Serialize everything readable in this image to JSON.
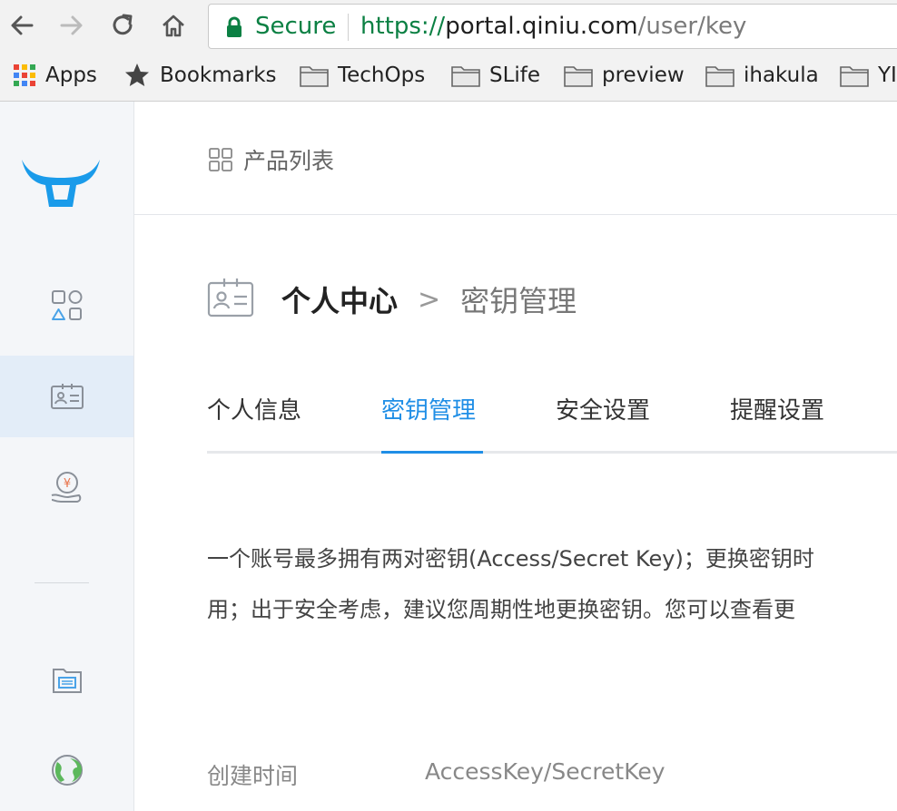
{
  "browser": {
    "security_label": "Secure",
    "url_scheme": "https://",
    "url_host": "portal.qiniu.com",
    "url_path": "/user/key",
    "nav": [
      "back-icon",
      "forward-icon",
      "reload-icon",
      "home-icon"
    ],
    "bookmarks": [
      {
        "label": "Apps",
        "icon": "apps-grid-icon"
      },
      {
        "label": "Bookmarks",
        "icon": "star-icon"
      },
      {
        "label": "TechOps",
        "icon": "folder-icon"
      },
      {
        "label": "SLife",
        "icon": "folder-icon"
      },
      {
        "label": "preview",
        "icon": "folder-icon"
      },
      {
        "label": "ihakula",
        "icon": "folder-icon"
      },
      {
        "label": "YI",
        "icon": "folder-icon"
      }
    ]
  },
  "sidebar": {
    "logo": "qiniu-logo",
    "items": [
      {
        "icon": "products-icon",
        "active": false
      },
      {
        "icon": "id-card-icon",
        "active": true
      },
      {
        "icon": "finance-icon",
        "active": false
      },
      {
        "icon": "ticket-icon",
        "active": false
      },
      {
        "icon": "globe-icon",
        "active": false
      }
    ]
  },
  "topbar": {
    "product_list_label": "产品列表"
  },
  "breadcrumb": {
    "root": "个人中心",
    "separator": ">",
    "current": "密钥管理"
  },
  "tabs": [
    {
      "label": "个人信息",
      "active": false
    },
    {
      "label": "密钥管理",
      "active": true
    },
    {
      "label": "安全设置",
      "active": false
    },
    {
      "label": "提醒设置",
      "active": false
    }
  ],
  "description": {
    "line1": "一个账号最多拥有两对密钥(Access/Secret Key)；更换密钥时",
    "line2": "用；出于安全考虑，建议您周期性地更换密钥。您可以查看更"
  },
  "table": {
    "headers": [
      "创建时间",
      "AccessKey/SecretKey"
    ]
  },
  "colors": {
    "accent": "#1f8ee6",
    "secure_green": "#0b8043",
    "sidebar_bg": "#f4f6f9",
    "sidebar_active": "#e3edf8"
  }
}
